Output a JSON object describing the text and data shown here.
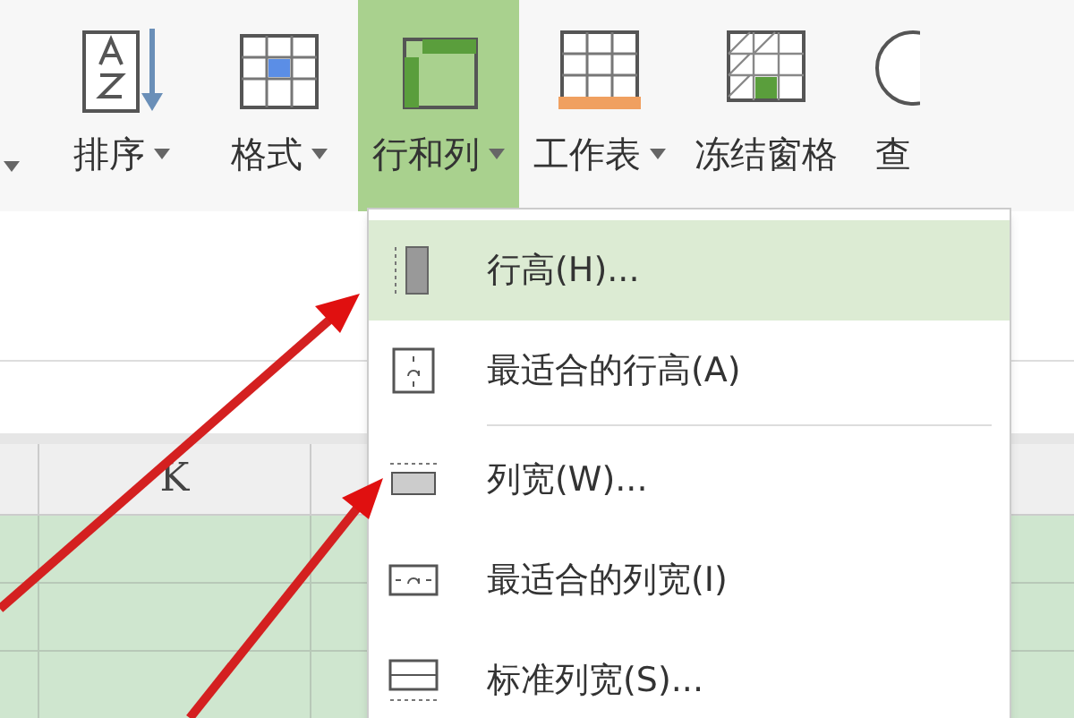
{
  "ribbon": {
    "buttons": [
      {
        "kind": "caret_only"
      },
      {
        "kind": "button",
        "label": "排序",
        "has_caret": true,
        "selected": false
      },
      {
        "kind": "button",
        "label": "格式",
        "has_caret": true,
        "selected": false
      },
      {
        "kind": "button",
        "label": "行和列",
        "has_caret": true,
        "selected": true
      },
      {
        "kind": "button",
        "label": "工作表",
        "has_caret": true,
        "selected": false
      },
      {
        "kind": "button",
        "label": "冻结窗格",
        "has_caret": false,
        "selected": false
      },
      {
        "kind": "button",
        "label": "查",
        "has_caret": false,
        "selected": false
      }
    ]
  },
  "sheet": {
    "column_header": "K"
  },
  "menu": {
    "items": [
      {
        "label": "行高(H)...",
        "selected": true,
        "divider_after": false
      },
      {
        "label": "最适合的行高(A)",
        "selected": false,
        "divider_after": true
      },
      {
        "label": "列宽(W)...",
        "selected": false,
        "divider_after": false
      },
      {
        "label": "最适合的列宽(I)",
        "selected": false,
        "divider_after": false
      },
      {
        "label": "标准列宽(S)...",
        "selected": false,
        "divider_after": false
      }
    ]
  }
}
